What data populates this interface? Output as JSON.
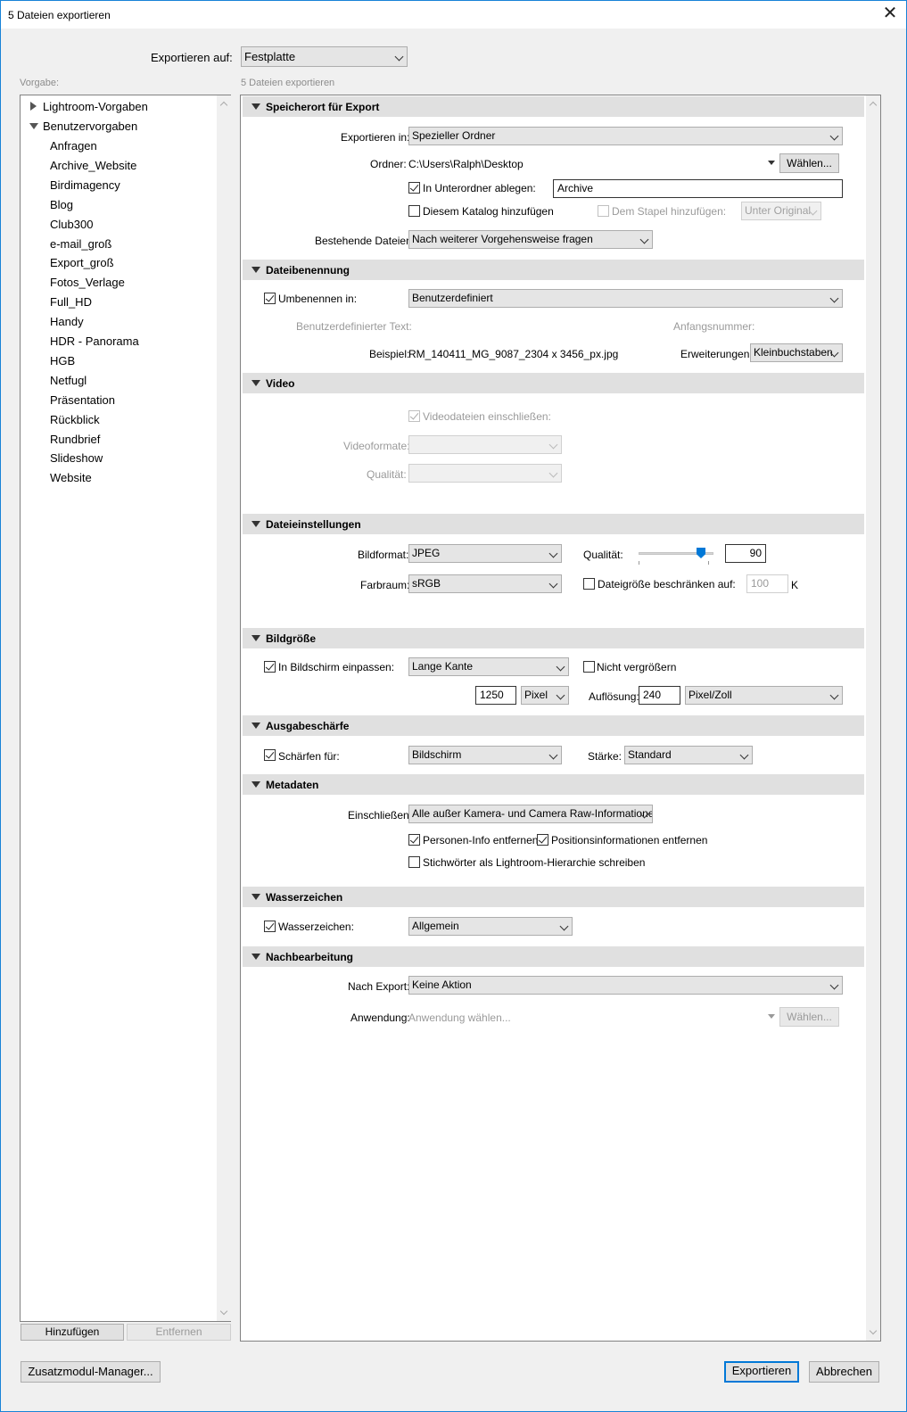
{
  "window": {
    "title": "5 Dateien exportieren"
  },
  "export_to": {
    "label": "Exportieren auf:",
    "value": "Festplatte"
  },
  "presets": {
    "label": "Vorgabe:",
    "groups": [
      {
        "label": "Lightroom-Vorgaben",
        "expanded": false
      },
      {
        "label": "Benutzervorgaben",
        "expanded": true
      }
    ],
    "items": [
      "Anfragen",
      "Archive_Website",
      "Birdimagency",
      "Blog",
      "Club300",
      "e-mail_groß",
      "Export_groß",
      "Fotos_Verlage",
      "Full_HD",
      "Handy",
      "HDR - Panorama",
      "HGB",
      "Netfugl",
      "Präsentation",
      "Rückblick",
      "Rundbrief",
      "Slideshow",
      "Website"
    ],
    "add_button": "Hinzufügen",
    "remove_button": "Entfernen"
  },
  "main_caption": "5 Dateien exportieren",
  "location": {
    "title": "Speicherort für Export",
    "export_in_label": "Exportieren in:",
    "export_in_value": "Spezieller Ordner",
    "folder_label": "Ordner:",
    "folder_value": "C:\\Users\\Ralph\\Desktop",
    "choose_button": "Wählen...",
    "subfolder_label": "In Unterordner ablegen:",
    "subfolder_value": "Archive",
    "catalog_label": "Diesem Katalog hinzufügen",
    "stack_label": "Dem Stapel hinzufügen:",
    "stack_value": "Unter Original",
    "existing_label": "Bestehende Dateien:",
    "existing_value": "Nach weiterer Vorgehensweise fragen"
  },
  "naming": {
    "title": "Dateibenennung",
    "rename_label": "Umbenennen in:",
    "rename_value": "Benutzerdefiniert",
    "custom_text_label": "Benutzerdefinierter Text:",
    "start_number_label": "Anfangsnummer:",
    "example_label": "Beispiel:",
    "example_value": "RM_140411_MG_9087_2304 x 3456_px.jpg",
    "extensions_label": "Erweiterungen:",
    "extensions_value": "Kleinbuchstaben"
  },
  "video": {
    "title": "Video",
    "include_label": "Videodateien einschließen:",
    "formats_label": "Videoformate:",
    "quality_label": "Qualität:"
  },
  "file_settings": {
    "title": "Dateieinstellungen",
    "format_label": "Bildformat:",
    "format_value": "JPEG",
    "quality_label": "Qualität:",
    "quality_value": "90",
    "quality_fraction": 0.9,
    "colorspace_label": "Farbraum:",
    "colorspace_value": "sRGB",
    "limit_label": "Dateigröße beschränken auf:",
    "limit_value": "100",
    "limit_unit": "K"
  },
  "image_size": {
    "title": "Bildgröße",
    "fit_label": "In Bildschirm einpassen:",
    "fit_value": "Lange Kante",
    "no_enlarge_label": "Nicht vergrößern",
    "size_value": "1250",
    "size_unit": "Pixel",
    "resolution_label": "Auflösung:",
    "resolution_value": "240",
    "resolution_unit": "Pixel/Zoll"
  },
  "sharpening": {
    "title": "Ausgabeschärfe",
    "sharpen_label": "Schärfen für:",
    "sharpen_value": "Bildschirm",
    "amount_label": "Stärke:",
    "amount_value": "Standard"
  },
  "metadata": {
    "title": "Metadaten",
    "include_label": "Einschließen:",
    "include_value": "Alle außer Kamera- und Camera Raw-Informationen",
    "remove_person_label": "Personen-Info entfernen",
    "remove_location_label": "Positionsinformationen entfernen",
    "keywords_label": "Stichwörter als Lightroom-Hierarchie schreiben"
  },
  "watermark": {
    "title": "Wasserzeichen",
    "label": "Wasserzeichen:",
    "value": "Allgemein"
  },
  "post": {
    "title": "Nachbearbeitung",
    "after_label": "Nach Export:",
    "after_value": "Keine Aktion",
    "app_label": "Anwendung:",
    "app_placeholder": "Anwendung wählen...",
    "choose_button": "Wählen..."
  },
  "footer": {
    "plugin_manager": "Zusatzmodul-Manager...",
    "export": "Exportieren",
    "cancel": "Abbrechen"
  }
}
